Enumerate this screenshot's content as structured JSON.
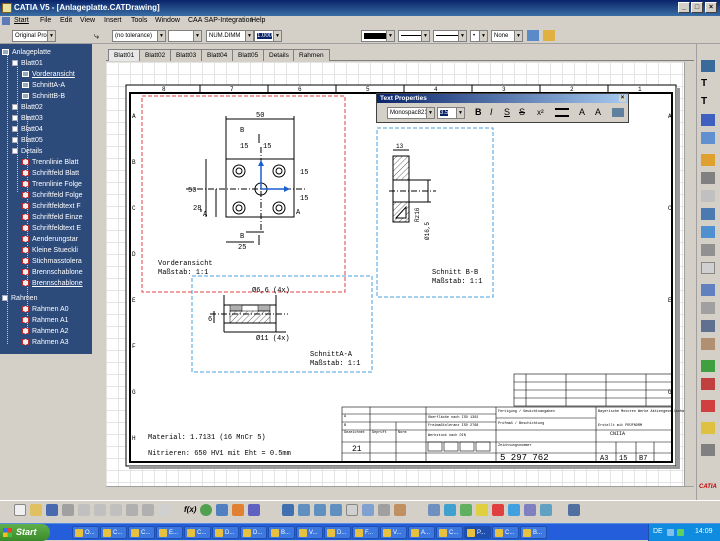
{
  "window": {
    "title": "CATIA V5 - [Anlageplatte.CATDrawing]",
    "minimize": "_",
    "maximize": "□",
    "close": "×"
  },
  "menu": [
    "Start",
    "File",
    "Edit",
    "View",
    "Insert",
    "Tools",
    "Window",
    "CAA SAP-Integration",
    "Help"
  ],
  "toolbar": {
    "style_combo": "Original Pro",
    "tolerance_combo": "(no tolerance)",
    "format_combo": "NUM.DIMM",
    "precision_combo": "1.000",
    "none_combo": "None"
  },
  "tree": {
    "root": "Anlageplatte",
    "blatt01": "Blatt01",
    "vorderansicht": "Vorderansicht",
    "schnitt_aa": "SchnittA-A",
    "schnitt_bb": "SchnittB-B",
    "blatt02": "Blatt02",
    "blatt03": "Blatt03",
    "blatt04": "Blatt04",
    "blatt05": "Blatt05",
    "details": "Details",
    "detail_items": [
      "Trennlinie Blatt",
      "Schriftfeld Blatt",
      "Trennlinie Folge",
      "Schriftfeld Folge",
      "Schriftfeldtext F",
      "Schriftfeld Einze",
      "Schriftfeldtext E",
      "Aenderungstar",
      "Kleine Stueckli",
      "Stichmasstolera",
      "Brennschablone",
      "Brennschablone"
    ],
    "rahmen": "Rahmen",
    "rahmen_items": [
      "Rahmen A0",
      "Rahmen A1",
      "Rahmen A2",
      "Rahmen A3"
    ]
  },
  "sheet_tabs": [
    "Blatt01",
    "Blatt02",
    "Blatt03",
    "Blatt04",
    "Blatt05",
    "Details",
    "Rahmen"
  ],
  "text_properties": {
    "title": "Text Properties",
    "font": "Monospac821",
    "size": "3.5",
    "bold": "B",
    "italic": "I",
    "strike": "S"
  },
  "drawing": {
    "col_labels": [
      "8",
      "7",
      "6",
      "5",
      "4",
      "3",
      "2",
      "1"
    ],
    "row_labels": [
      "A",
      "B",
      "C",
      "D",
      "E",
      "F",
      "G",
      "H"
    ],
    "front_view": {
      "label": "Vorderansicht",
      "scale": "Maßstab:  1:1",
      "dim_top": "50",
      "dim_15a": "15",
      "dim_15b": "15",
      "dim_left": "50",
      "dim_28": "28",
      "dim_15c": "15",
      "dim_15d": "15",
      "dim_bottom": "25",
      "sec_b_top": "B",
      "sec_b_bottom": "B",
      "sec_a_left": "A",
      "sec_a_right": "A"
    },
    "section_aa": {
      "label": "SchnittA-A",
      "scale": "Maßstab:  1:1",
      "dia1": "Ø6,6 (4x)",
      "dia2": "Ø11 (4x)",
      "dim_6": "6"
    },
    "section_bb": {
      "label": "Schnitt B-B",
      "scale": "Maßstab:  1:1",
      "dim_13": "13",
      "dim_rtext": "Rz16",
      "dim_dia": "Ø16,5"
    },
    "material": "Material:  1.7131 (16 MnCr 5)",
    "hardening": "Nitrieren: 650 HV1 mit Eht = 0.5mm",
    "title_block": {
      "drawing_no": "5 297 762",
      "format": "A3",
      "sheet": "15",
      "rev": "B7",
      "company": "Bayerische Motoren Werke Aktiengesellschaft",
      "part_name": "CNIIA",
      "qty": "21"
    }
  },
  "taskbar": {
    "start": "Start",
    "tasks": [
      "O...",
      "C...",
      "C...",
      "E...",
      "C...",
      "D...",
      "D...",
      "B...",
      "V...",
      "D...",
      "F...",
      "V...",
      "A...",
      "C...",
      "P...",
      "C...",
      "B..."
    ],
    "lang": "DE",
    "time": "14:09"
  }
}
